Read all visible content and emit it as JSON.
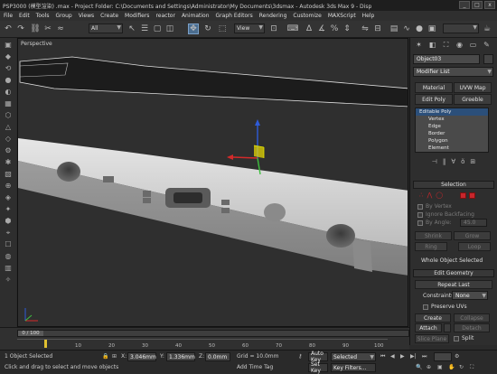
{
  "window": {
    "title": "PSP3000 (模型渲染) .max   - Project Folder: C:\\Documents and Settings\\Administrator\\My Documents\\3dsmax   - Autodesk 3ds Max 9   - Disp",
    "controls": [
      "_",
      "□",
      "x"
    ]
  },
  "menu": [
    "File",
    "Edit",
    "Tools",
    "Group",
    "Views",
    "Create",
    "Modifiers",
    "reactor",
    "Animation",
    "Graph Editors",
    "Rendering",
    "Customize",
    "MAXScript",
    "Help"
  ],
  "toolbar": {
    "selection_filter": "All",
    "ref_coord": "View"
  },
  "viewport": {
    "label": "Perspective"
  },
  "command_panel": {
    "object_name": "Object03",
    "modifier_list": "Modifier List",
    "buttons": [
      "Material",
      "UVW Map",
      "Edit Poly",
      "Greeble"
    ],
    "stack": {
      "top": "Editable Poly",
      "subs": [
        "Vertex",
        "Edge",
        "Border",
        "Polygon",
        "Element"
      ]
    },
    "selection": {
      "title": "Selection",
      "by_vertex": "By Vertex",
      "ignore_backfacing": "Ignore Backfacing",
      "by_angle": "By Angle:",
      "angle_value": "45.0",
      "shrink": "Shrink",
      "grow": "Grow",
      "ring": "Ring",
      "loop": "Loop",
      "status": "Whole Object Selected"
    },
    "edit_geometry": {
      "title": "Edit Geometry",
      "repeat_last": "Repeat Last",
      "constraints": "Constraints:",
      "constraint_value": "None",
      "preserve_uvs": "Preserve UVs",
      "create": "Create",
      "collapse": "Collapse",
      "attach": "Attach",
      "detach": "Detach",
      "slice_plane": "Slice Plane",
      "split": "Split"
    }
  },
  "timeline": {
    "frame": "0 / 100",
    "ticks": [
      "10",
      "20",
      "30",
      "40",
      "50",
      "60",
      "70",
      "80",
      "90",
      "100"
    ]
  },
  "status": {
    "selection": "1 Object Selected",
    "prompt": "Click and drag to select and move objects",
    "x_label": "X:",
    "x_value": "3.046mm",
    "y_label": "Y:",
    "y_value": "1.336mm",
    "z_label": "Z:",
    "z_value": "0.0mm",
    "grid": "Grid = 10.0mm",
    "add_time_tag": "Add Time Tag",
    "auto_key": "Auto Key",
    "set_key": "Set Key",
    "key_mode": "Selected",
    "key_filters": "Key Filters..."
  }
}
